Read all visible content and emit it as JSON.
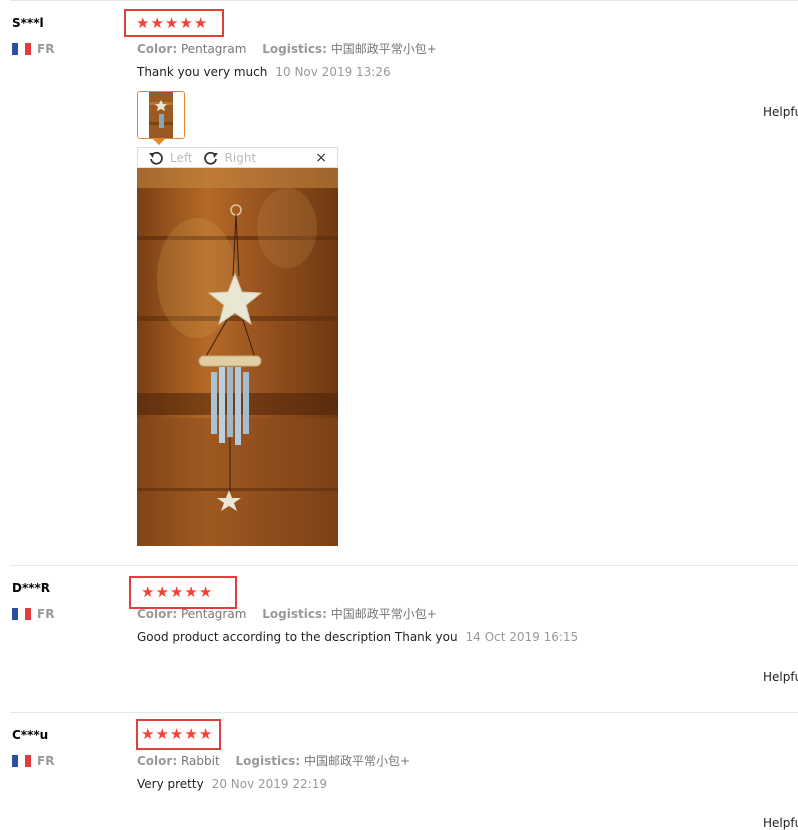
{
  "reviews": [
    {
      "user": "S***l",
      "country": "FR",
      "rating": 5,
      "color_label": "Color:",
      "color_value": "Pentagram",
      "logistics_label": "Logistics:",
      "logistics_value": "中国邮政平常小包+",
      "comment": "Thank you very much",
      "date": "10 Nov 2019 13:26",
      "helpful": "Helpfu"
    },
    {
      "user": "D***R",
      "country": "FR",
      "rating": 5,
      "color_label": "Color:",
      "color_value": "Pentagram",
      "logistics_label": "Logistics:",
      "logistics_value": "中国邮政平常小包+",
      "comment": "Good product according to the description Thank you",
      "date": "14 Oct 2019 16:15",
      "helpful": "Helpfu"
    },
    {
      "user": "C***u",
      "country": "FR",
      "rating": 5,
      "color_label": "Color:",
      "color_value": "Rabbit",
      "logistics_label": "Logistics:",
      "logistics_value": "中国邮政平常小包+",
      "comment": "Very pretty",
      "date": "20 Nov 2019 22:19",
      "helpful": "Helpfu"
    }
  ],
  "image_viewer": {
    "rotate_left": "Left",
    "rotate_right": "Right",
    "close": "×"
  },
  "icons": {
    "star": "star-icon",
    "flag": "flag-fr-icon",
    "rotate_left": "rotate-left-icon",
    "rotate_right": "rotate-right-icon",
    "close": "close-icon"
  },
  "colors": {
    "star": "#f44336",
    "highlight_box": "#e0403a",
    "thumb_border": "#e08a2a"
  }
}
